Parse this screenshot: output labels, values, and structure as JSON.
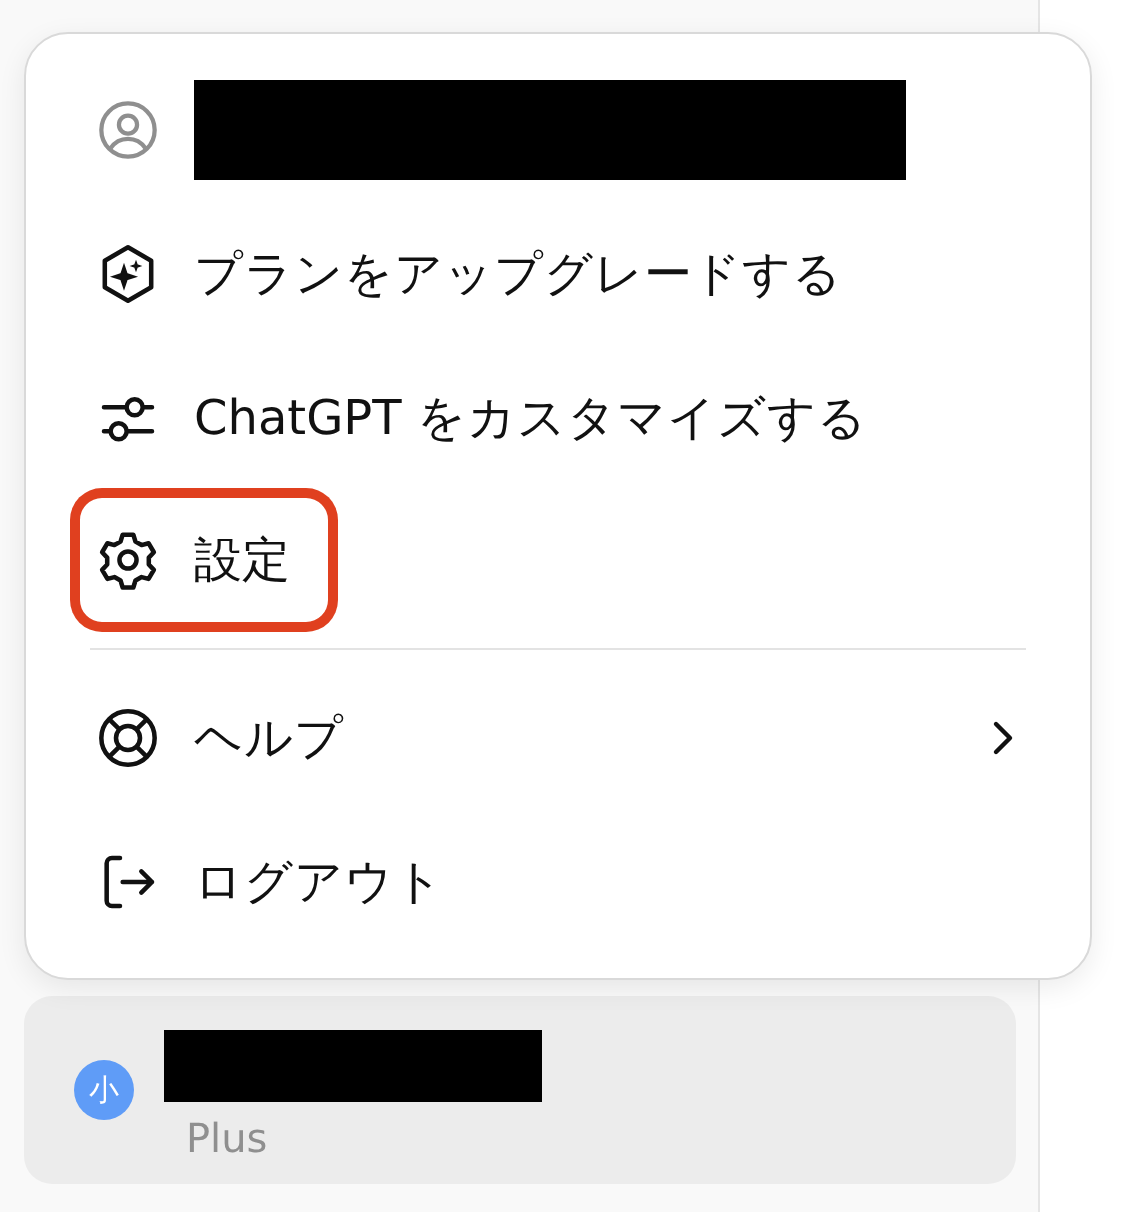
{
  "menu": {
    "items": [
      {
        "kind": "account",
        "highlighted": false,
        "has_submenu": false
      },
      {
        "kind": "upgrade",
        "label": "プランをアップグレードする",
        "highlighted": false,
        "has_submenu": false
      },
      {
        "kind": "customize",
        "label": "ChatGPT をカスタマイズする",
        "highlighted": false,
        "has_submenu": false
      },
      {
        "kind": "settings",
        "label": "設定",
        "highlighted": true,
        "has_submenu": false
      },
      {
        "kind": "divider"
      },
      {
        "kind": "help",
        "label": "ヘルプ",
        "highlighted": false,
        "has_submenu": true
      },
      {
        "kind": "logout",
        "label": "ログアウト",
        "highlighted": false,
        "has_submenu": false
      }
    ]
  },
  "user": {
    "avatar": "小",
    "plan": "Plus"
  }
}
